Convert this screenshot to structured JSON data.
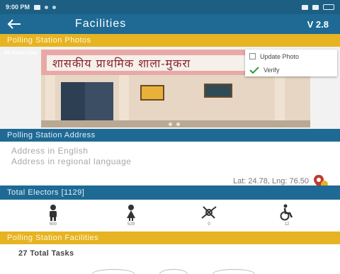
{
  "status_bar": {
    "time": "9:00 PM",
    "icons": [
      "sim-icon",
      "notification-icon",
      "wifi-icon",
      "signal-icon",
      "battery-icon"
    ]
  },
  "app_bar": {
    "title": "Facilities",
    "version": "V 2.8",
    "back_icon": "arrow-left-icon"
  },
  "photos_section": {
    "header": "Polling Station Photos",
    "photo_label": "PS Front View",
    "menu": {
      "update_label": "Update Photo",
      "verify_label": "Verify"
    },
    "photo_signboard_text": "शासकीय प्राथमिक शाला-मुकरा"
  },
  "address_section": {
    "header": "Polling Station Address",
    "address_english": "Address in English",
    "address_regional": "Address in regional language",
    "coordinates": "Lat: 24.78, Lng: 76.50"
  },
  "electors": {
    "header": "Total Electors [1129]",
    "categories": [
      {
        "icon": "male-voter-icon",
        "count": "600"
      },
      {
        "icon": "female-voter-icon",
        "count": "529"
      },
      {
        "icon": "third-gender-icon",
        "count": "0"
      },
      {
        "icon": "pwd-voter-icon",
        "count": "12"
      }
    ]
  },
  "facilities_section": {
    "header": "Polling Station Facilities",
    "total_tasks": "27 Total Tasks"
  },
  "colors": {
    "primary": "#1e6a95",
    "accent": "#e6b422",
    "pin": "#c0392b"
  }
}
